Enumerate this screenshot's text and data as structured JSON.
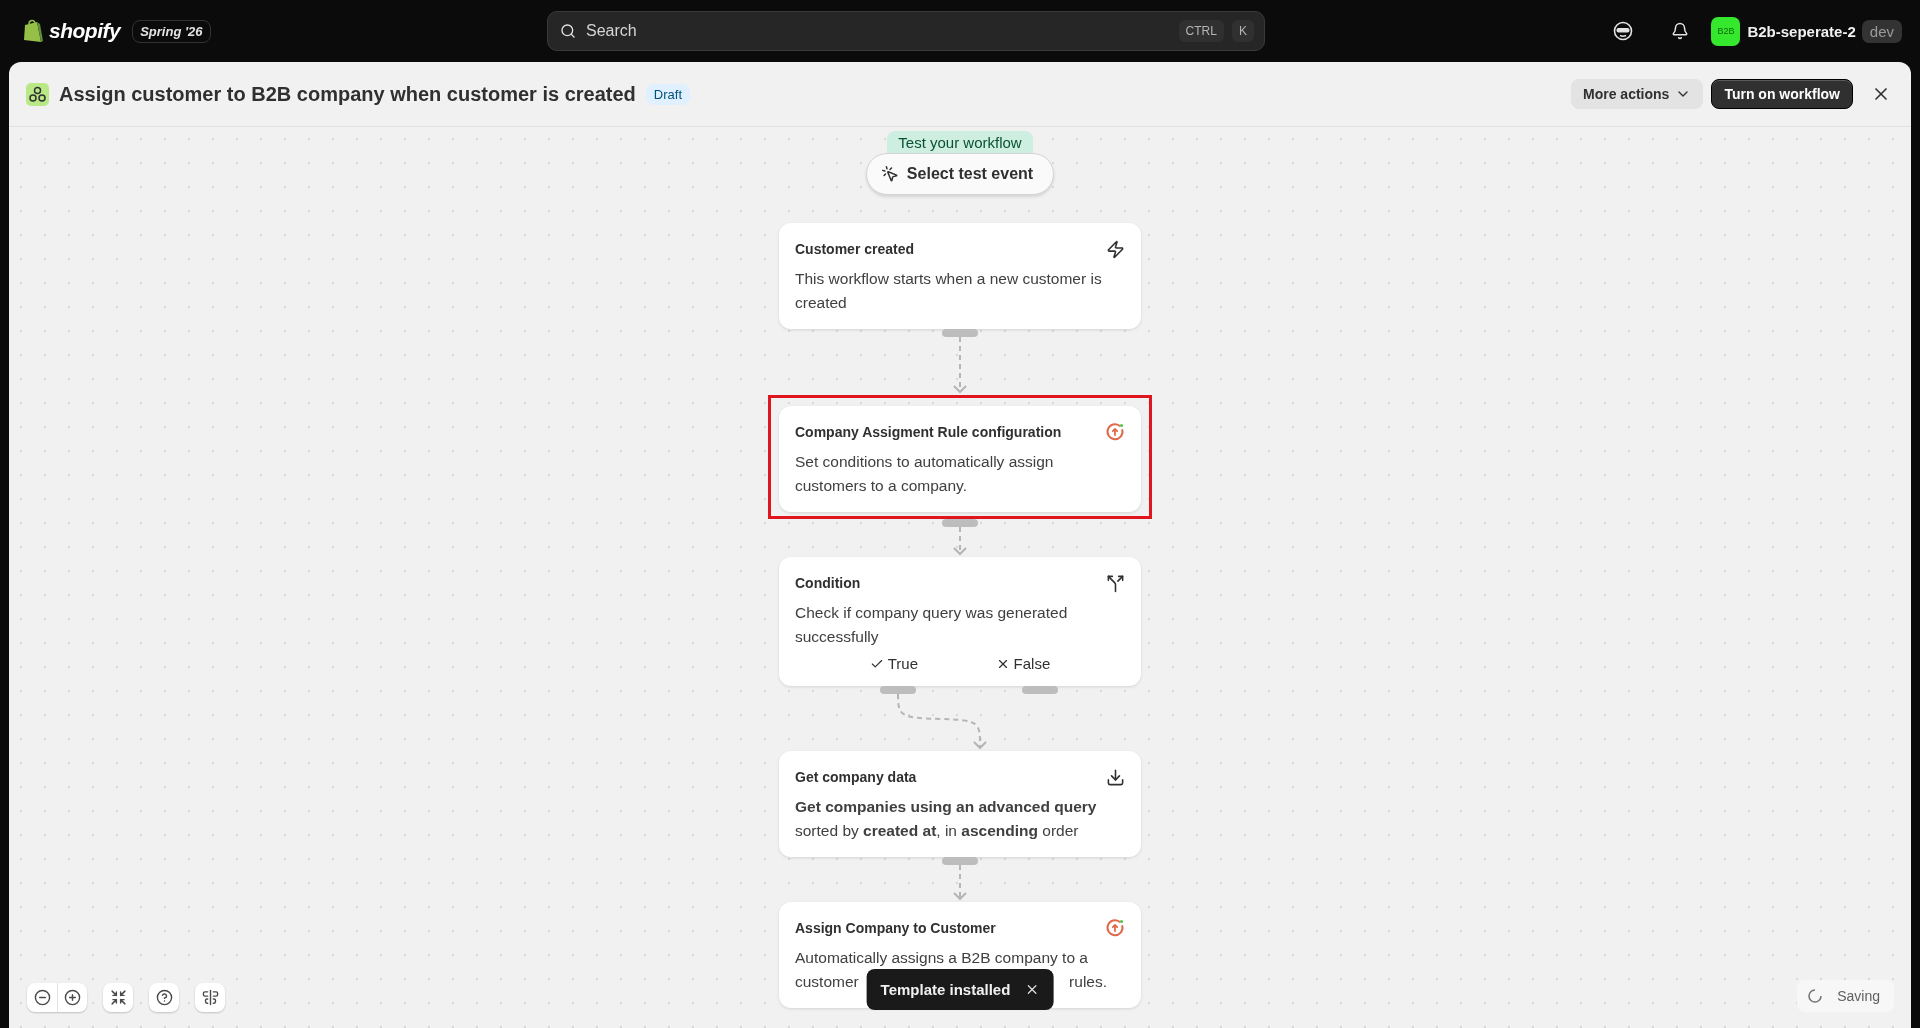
{
  "topbar": {
    "logo": "shopify",
    "edition": "Spring '26",
    "search": {
      "placeholder": "Search",
      "shortcut": [
        "CTRL",
        "K"
      ]
    },
    "avatar": "B2B",
    "store": "B2b-seperate-2",
    "store_badge": "dev"
  },
  "header": {
    "title": "Assign customer to B2B company when customer is created",
    "status": "Draft",
    "actions": [
      {
        "label": "More actions",
        "kind": "menu"
      },
      {
        "label": "Turn on workflow",
        "kind": "primary"
      }
    ]
  },
  "test": {
    "label": "Test your workflow",
    "button": "Select test event"
  },
  "nodes": [
    {
      "kind": "trigger",
      "title": "Customer created",
      "description": "This workflow starts when a new customer is created",
      "highlighted": false
    },
    {
      "kind": "app",
      "title": "Company Assigment Rule configuration",
      "description": "Set conditions to automatically assign customers to a company.",
      "highlighted": true
    },
    {
      "kind": "condition",
      "title": "Condition",
      "description": "Check if company query was generated successfully",
      "branches": [
        {
          "label": "True",
          "kind": "check"
        },
        {
          "label": "False",
          "kind": "cross"
        }
      ],
      "highlighted": false
    },
    {
      "kind": "data",
      "title": "Get company data",
      "description": "**Get companies using an advanced query** sorted by **created at**, in **ascending** order",
      "highlighted": false
    },
    {
      "kind": "app",
      "title": "Assign Company to Customer",
      "description_lines": [
        "Automatically assigns a B2B company to a",
        "customer"
      ],
      "description_tail": "rules.",
      "highlighted": false
    }
  ],
  "toast": "Template installed",
  "status": "Saving"
}
